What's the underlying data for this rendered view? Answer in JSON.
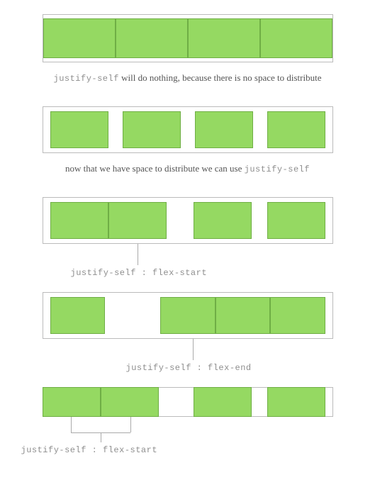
{
  "examples": {
    "ex1": {
      "caption_pre_code": "justify-self",
      "caption_text": " will do nothing, because there is no space to distribute"
    },
    "ex2": {
      "caption_text": "now that we have space to distribute we can use ",
      "caption_post_code": "justify-self"
    },
    "ex3": {
      "callout_label": "justify-self : flex-start"
    },
    "ex4": {
      "callout_label": "justify-self : flex-end"
    },
    "ex5": {
      "callout_label": "justify-self : flex-start"
    }
  },
  "colors": {
    "item_fill": "#95d962",
    "item_border": "#6fae45",
    "container_border": "#bbbbbb",
    "text": "#555555",
    "code": "#8e8e8e",
    "line": "#aaaaaa"
  }
}
